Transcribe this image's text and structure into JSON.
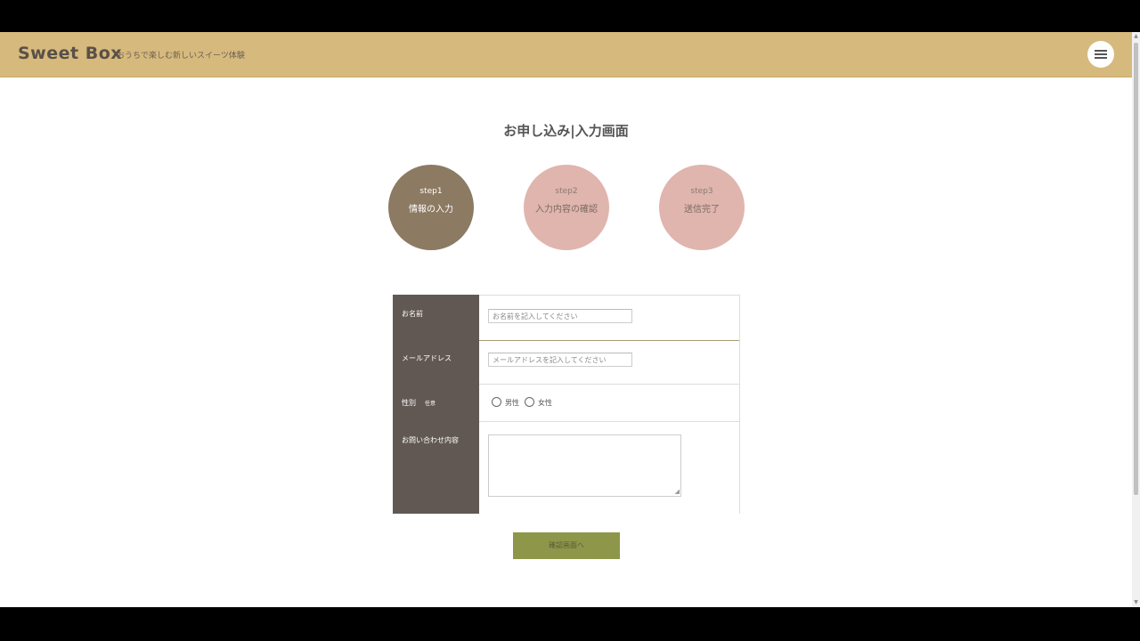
{
  "header": {
    "logo": "Sweet Box",
    "tagline": "おうちで楽しむ新しいスイーツ体験",
    "menu_icon": "hamburger-menu-icon"
  },
  "page": {
    "title": "お申し込み|入力画面"
  },
  "steps": [
    {
      "num": "step1",
      "label": "情報の入力",
      "active": true
    },
    {
      "num": "step2",
      "label": "入力内容の確認",
      "active": false
    },
    {
      "num": "step3",
      "label": "送信完了",
      "active": false
    }
  ],
  "form": {
    "name": {
      "label": "お名前",
      "placeholder": "お名前を記入してください"
    },
    "email": {
      "label": "メールアドレス",
      "placeholder": "メールアドレスを記入してください"
    },
    "gender": {
      "label": "性別",
      "optional": "任意",
      "options": [
        "男性",
        "女性"
      ]
    },
    "inquiry": {
      "label": "お問い合わせ内容"
    }
  },
  "submit": {
    "label": "確認画面へ"
  },
  "colors": {
    "header_bg": "#d6b97c",
    "step_active": "#8c7a62",
    "step_inactive": "#dfb5ae",
    "form_sidebar": "#625853",
    "submit_bg": "#8e964a"
  }
}
